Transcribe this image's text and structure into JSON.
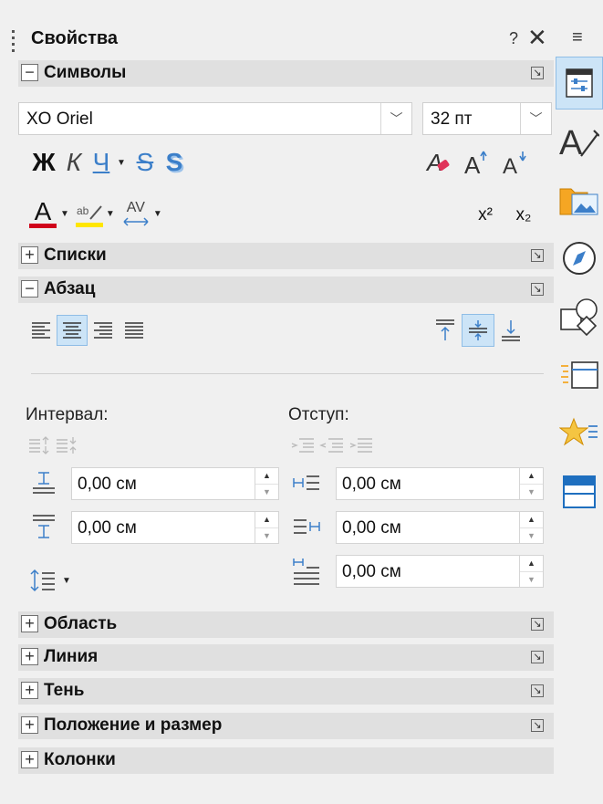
{
  "panel": {
    "title": "Свойства",
    "help_label": "?",
    "close_label": "✕",
    "menu_label": "≡"
  },
  "sections": {
    "symbols": {
      "label": "Символы",
      "toggle": "−"
    },
    "lists": {
      "label": "Списки",
      "toggle": "+"
    },
    "paragraph": {
      "label": "Абзац",
      "toggle": "−"
    },
    "area": {
      "label": "Область",
      "toggle": "+"
    },
    "line": {
      "label": "Линия",
      "toggle": "+"
    },
    "shadow": {
      "label": "Тень",
      "toggle": "+"
    },
    "position": {
      "label": "Положение и размер",
      "toggle": "+"
    },
    "columns": {
      "label": "Колонки",
      "toggle": "+"
    }
  },
  "font": {
    "name": "XO Oriel",
    "size": "32 пт"
  },
  "format_letters": {
    "bold": "Ж",
    "italic": "К",
    "underline": "Ч",
    "strike": "S",
    "shadow": "S",
    "font_color": "A",
    "spacing": "AV",
    "grow": "A",
    "shrink": "A",
    "superscript": "x²",
    "subscript": "x₂"
  },
  "colors": {
    "font_color_bar": "#d0021b",
    "highlight_bar": "#ffe600",
    "accent_blue": "#3c7fc9"
  },
  "spacing": {
    "interval_label": "Интервал:",
    "indent_label": "Отступ:",
    "above_value": "0,00 см",
    "below_value": "0,00 см",
    "indent_before_value": "0,00 см",
    "indent_after_value": "0,00 см",
    "first_line_value": "0,00 см"
  }
}
